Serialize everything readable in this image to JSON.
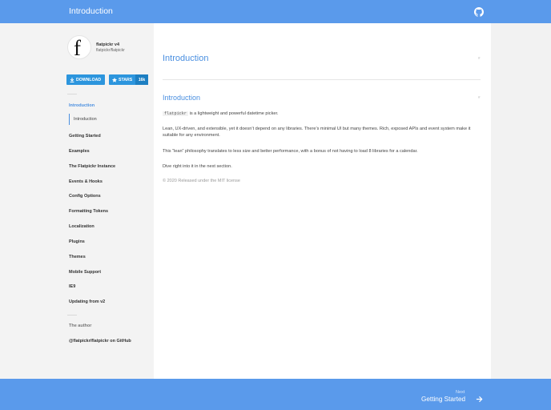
{
  "topbar": {
    "title": "Introduction",
    "github_icon": "github-icon"
  },
  "brand": {
    "logo_letter": "f",
    "name": "flatpickr v4",
    "repo": "flatpickr/flatpickr"
  },
  "buttons": {
    "download": "DOWNLOAD",
    "stars": "STARS",
    "stars_count": "16k"
  },
  "nav": {
    "active_section": "Introduction",
    "active_sub": "Introduction",
    "items": [
      "Getting Started",
      "Examples",
      "The Flatpickr Instance",
      "Events & Hooks",
      "Config Options",
      "Formatting Tokens",
      "Localization",
      "Plugins",
      "Themes",
      "Mobile Support",
      "IE9",
      "Updating from v2"
    ],
    "author_label": "The author",
    "github_link": "@flatpickr/flatpickr on GitHub"
  },
  "main": {
    "title": "Introduction",
    "heading": "Introduction",
    "hash": "#",
    "para1_code": "flatpickr",
    "para1_text": " is a lightweight and powerful datetime picker.",
    "para2": "Lean, UX-driven, and extensible, yet it doesn’t depend on any libraries. There’s minimal UI but many themes. Rich, exposed APIs and event system make it suitable for any environment.",
    "para3": "This “lean” philosophy translates to less size and better performance, with a bonus of not having to load 8 libraries for a calendar.",
    "para4": "Dive right into it in the next section.",
    "footer_note": "© 2020 Released under the MIT license"
  },
  "pager": {
    "next_label": "Next",
    "next_title": "Getting Started"
  },
  "colors": {
    "accent": "#5a9aeb",
    "link": "#4a8fe0",
    "button": "#2c95dd"
  }
}
